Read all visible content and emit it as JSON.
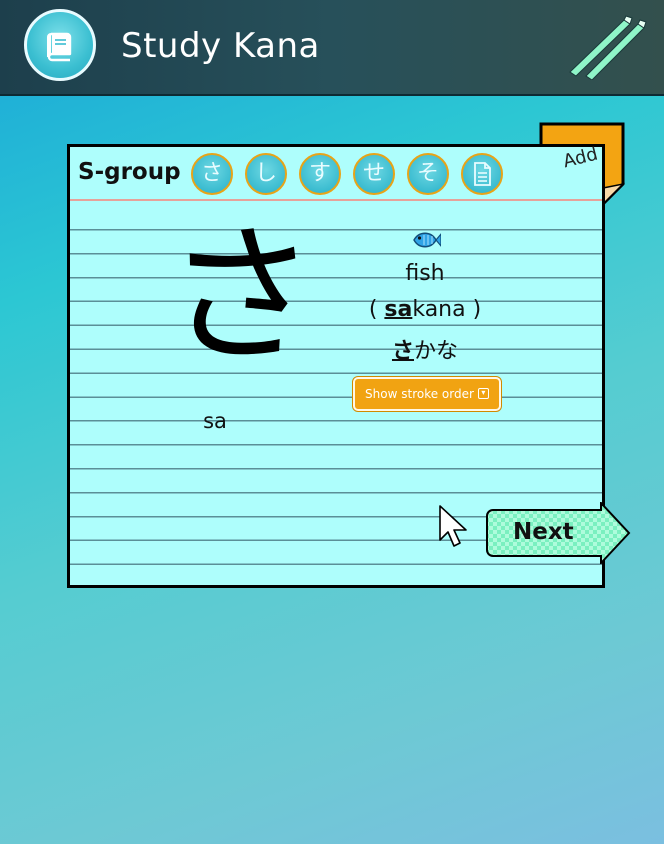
{
  "header": {
    "title": "Study Kana",
    "logo_icon": "book-icon",
    "edit_icon": "pencil-icon"
  },
  "card": {
    "group_label": "S-group",
    "kana_buttons": [
      "さ",
      "し",
      "す",
      "せ",
      "そ"
    ],
    "notes_icon": "document-icon",
    "add_label": "Add",
    "big_kana": "さ",
    "romaji": "sa",
    "word_icon": "fish-icon",
    "word_english": "fish",
    "word_romaji_open": "( ",
    "word_romaji_highlight": "sa",
    "word_romaji_rest": "kana )",
    "word_kana_highlight": "さ",
    "word_kana_rest": "かな",
    "stroke_order_label": "Show stroke order",
    "next_label": "Next"
  },
  "colors": {
    "card_background": "#aefefc",
    "accent_orange": "#f1a312",
    "header_dark": "#1d3f4c",
    "kana_button": "#3bbcd0"
  }
}
